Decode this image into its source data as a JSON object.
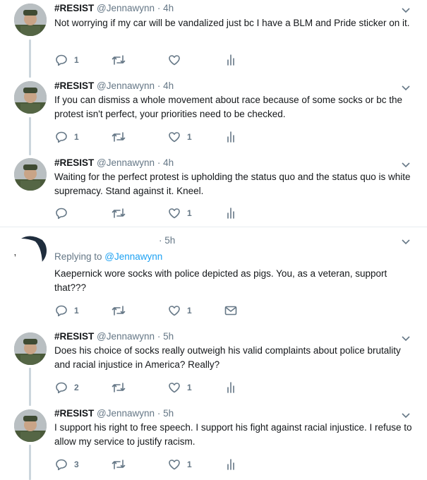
{
  "tweets": [
    {
      "name": "#RESIST",
      "handle": "@Jennawynn",
      "dot": "·",
      "time": "4h",
      "text": "Not worrying if my car will be vandalized just bc I have a BLM and Pride sticker on it.",
      "replies": "1",
      "retweets": "",
      "likes": ""
    },
    {
      "name": "#RESIST",
      "handle": "@Jennawynn",
      "dot": "·",
      "time": "4h",
      "text": "If you can dismiss a whole movement about race because of some socks or bc the protest isn't perfect, your priorities need to be checked.",
      "replies": "1",
      "retweets": "",
      "likes": "1"
    },
    {
      "name": "#RESIST",
      "handle": "@Jennawynn",
      "dot": "·",
      "time": "4h",
      "text": "Waiting for the perfect protest is upholding the status quo and the status quo is white supremacy. Stand against it. Kneel.",
      "replies": "",
      "retweets": "",
      "likes": "1"
    },
    {
      "name": "",
      "handle": "",
      "dot": "·",
      "time": "5h",
      "reply_prefix": "Replying to ",
      "reply_handle": "@Jennawynn",
      "text": "Kaepernick wore socks with police depicted as pigs.  You, as a veteran, support that???",
      "replies": "1",
      "retweets": "",
      "likes": "1"
    },
    {
      "name": "#RESIST",
      "handle": "@Jennawynn",
      "dot": "·",
      "time": "5h",
      "text": "Does his choice of socks really outweigh his valid complaints about police brutality and racial injustice in America? Really?",
      "replies": "2",
      "retweets": "",
      "likes": "1"
    },
    {
      "name": "#RESIST",
      "handle": "@Jennawynn",
      "dot": "·",
      "time": "5h",
      "text": "I support his right to free speech. I support his fight against racial injustice. I refuse to allow my service to justify racism.",
      "replies": "3",
      "retweets": "",
      "likes": "1"
    }
  ],
  "colors": {
    "accent": "#1da1f2",
    "muted": "#657786",
    "thread": "#ccd6dd",
    "divider": "#e6ecf0"
  },
  "icons": [
    "reply-icon",
    "retweet-icon",
    "like-icon",
    "analytics-icon",
    "message-icon",
    "chevron-down-icon"
  ]
}
